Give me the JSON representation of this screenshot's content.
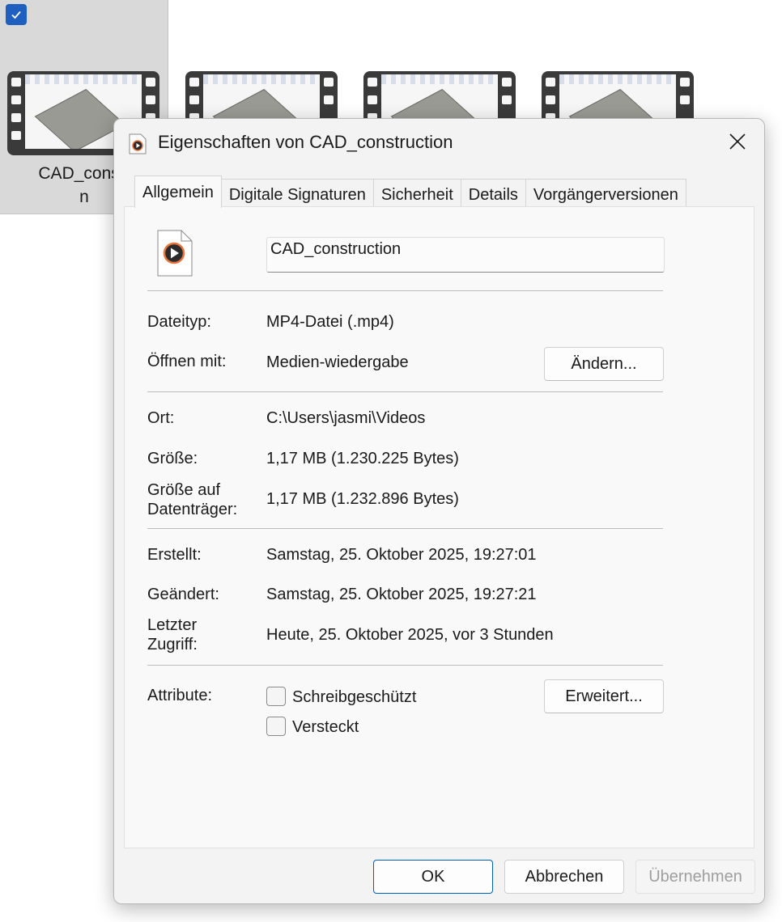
{
  "explorer": {
    "selected_label_line1": "CAD_constr",
    "selected_label_line2": "n"
  },
  "dialog": {
    "title": "Eigenschaften von CAD_construction",
    "tabs": [
      "Allgemein",
      "Digitale Signaturen",
      "Sicherheit",
      "Details",
      "Vorgängerversionen"
    ],
    "file_name": "CAD_construction",
    "rows": {
      "type_label": "Dateityp:",
      "type_value": "MP4-Datei (.mp4)",
      "open_label": "Öffnen mit:",
      "open_value": "Medien-wiedergabe",
      "change_button": "Ändern...",
      "location_label": "Ort:",
      "location_value": "C:\\Users\\jasmi\\Videos",
      "size_label": "Größe:",
      "size_value": "1,17 MB (1.230.225 Bytes)",
      "disk_size_label_1": "Größe auf",
      "disk_size_label_2": "Datenträger:",
      "disk_size_value": "1,17 MB (1.232.896 Bytes)",
      "created_label": "Erstellt:",
      "created_value": "Samstag, 25. Oktober 2025, 19:27:01",
      "modified_label": "Geändert:",
      "modified_value": "Samstag, 25. Oktober 2025, 19:27:21",
      "accessed_label_1": "Letzter",
      "accessed_label_2": "Zugriff:",
      "accessed_value": "Heute, 25. Oktober 2025, vor 3 Stunden",
      "attributes_label": "Attribute:",
      "readonly_label": "Schreibgeschützt",
      "hidden_label": "Versteckt",
      "advanced_button": "Erweitert..."
    },
    "footer": {
      "ok": "OK",
      "cancel": "Abbrechen",
      "apply": "Übernehmen"
    }
  },
  "colors": {
    "accent": "#005fb8",
    "dialog_bg": "#f3f3f3",
    "disabled_text": "#9e9e9e"
  }
}
